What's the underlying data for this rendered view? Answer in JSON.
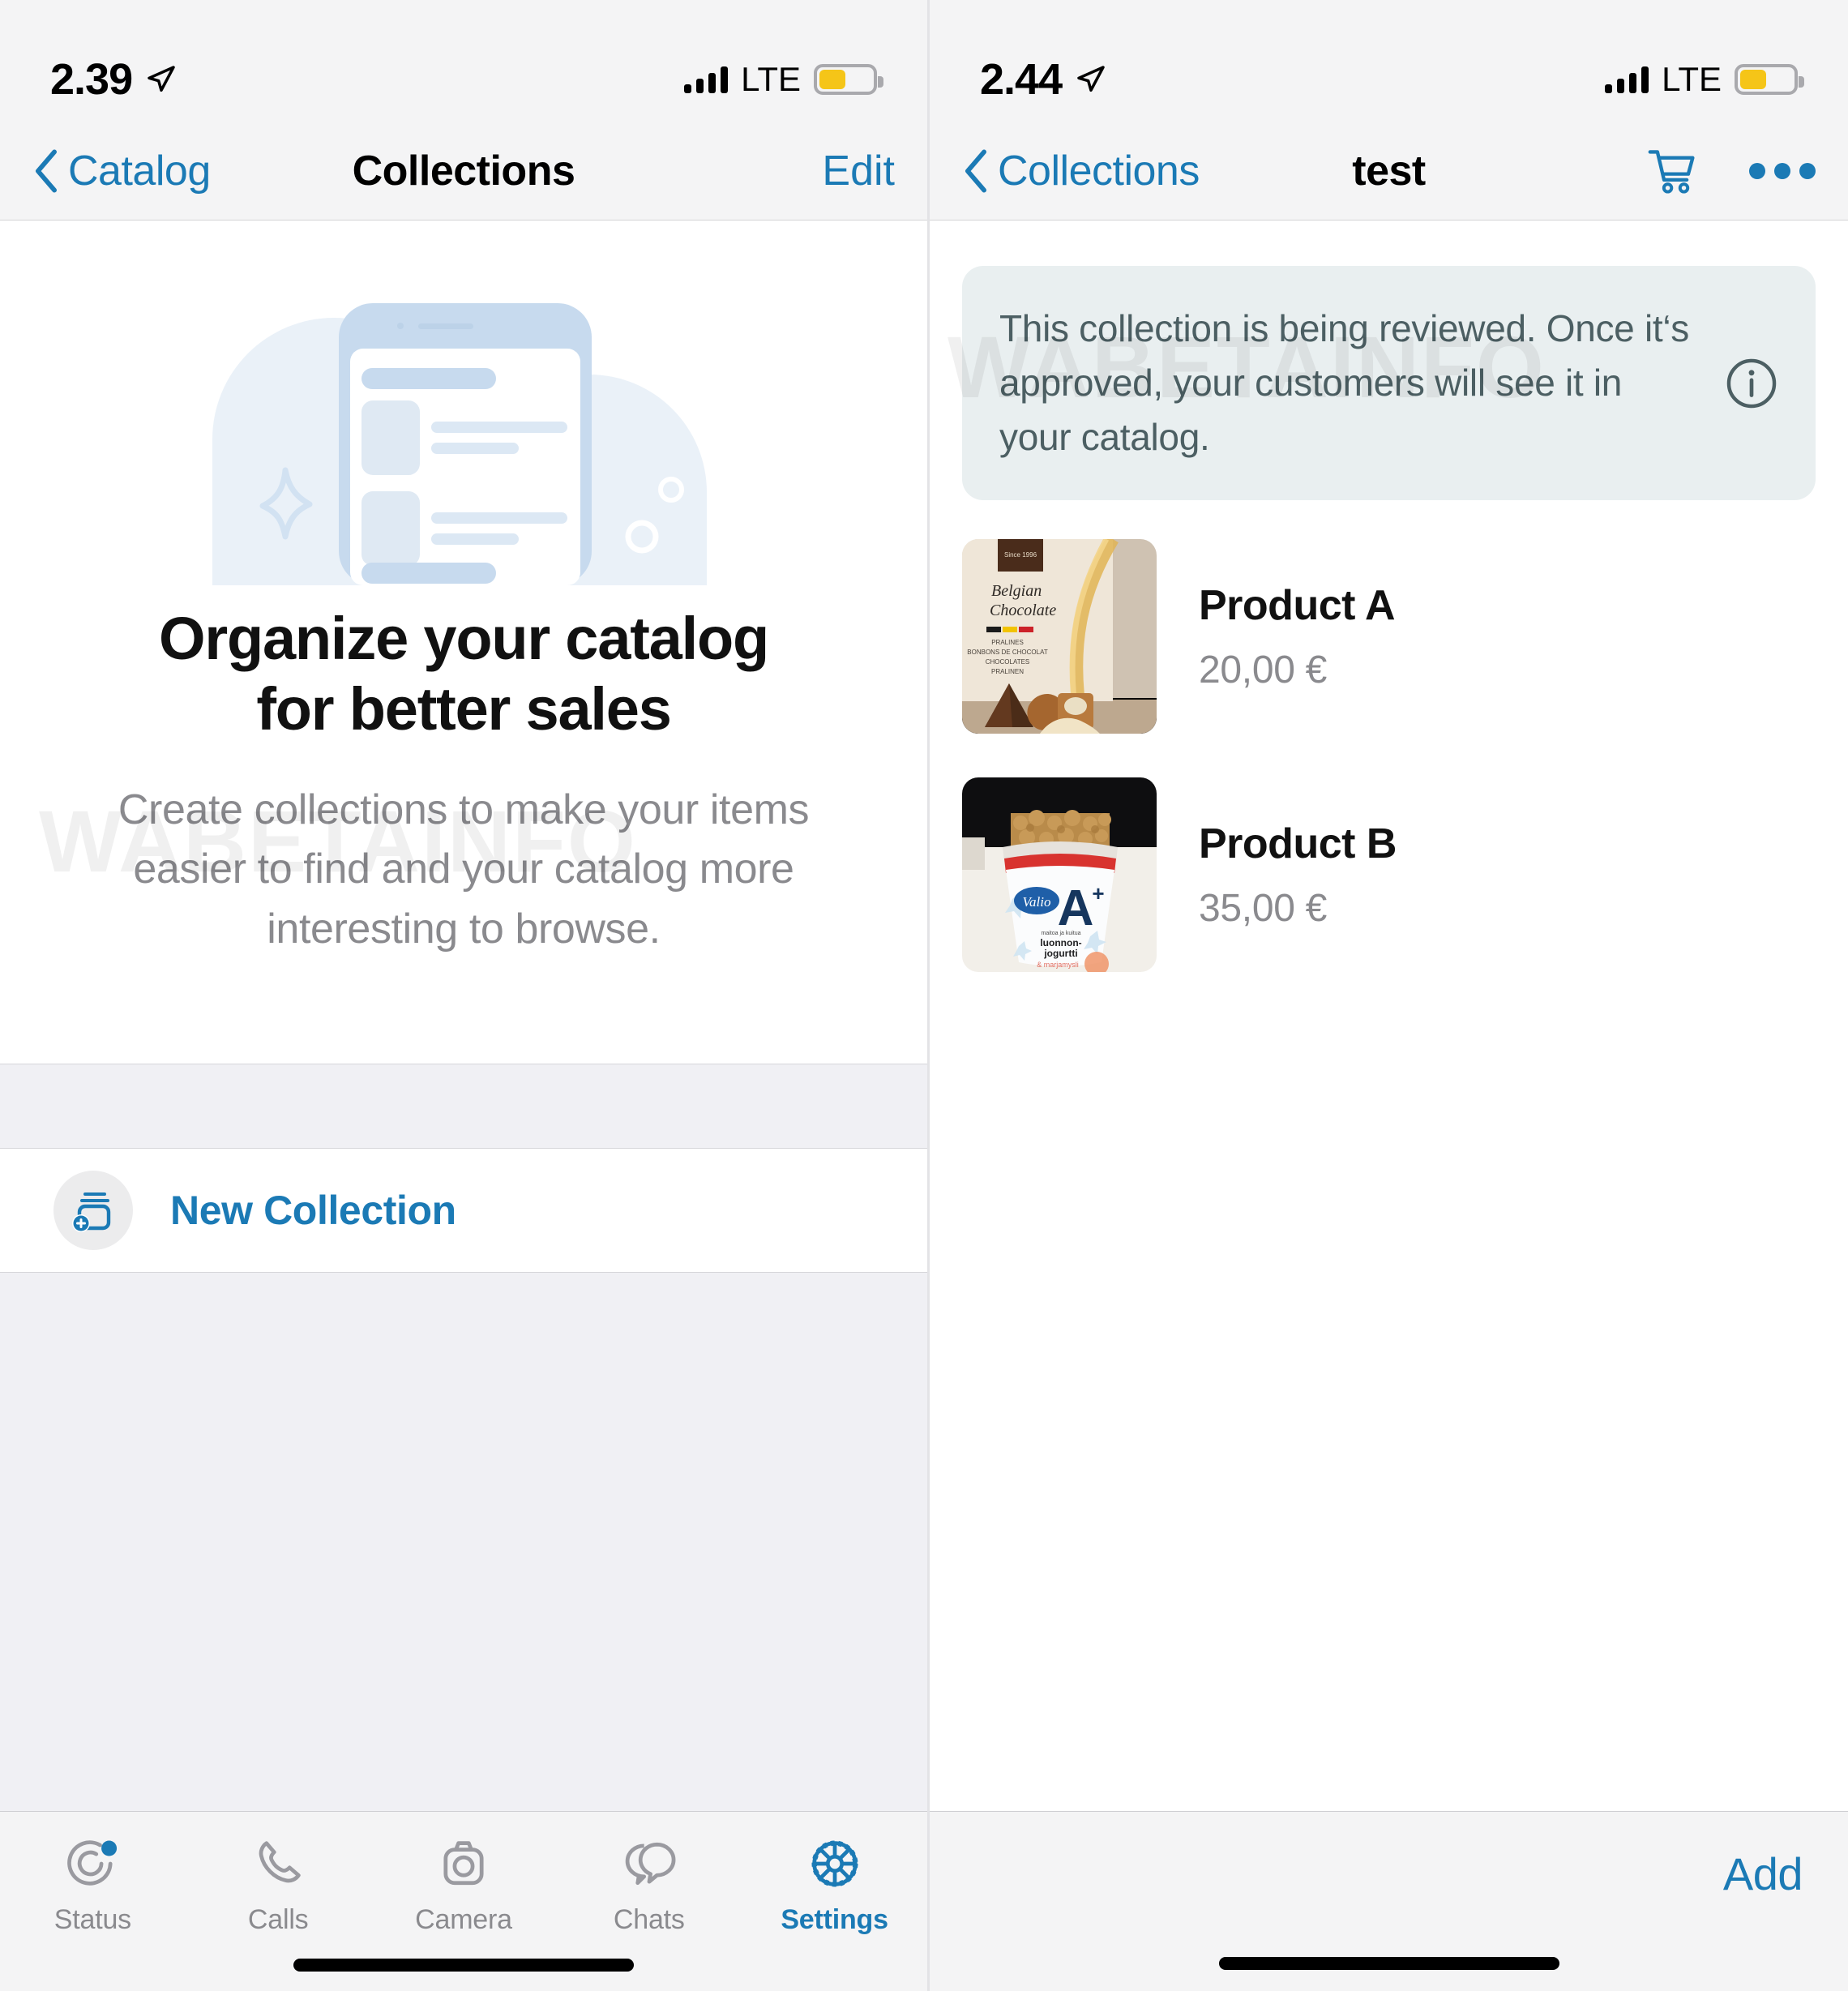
{
  "watermark": "WABETAINFO",
  "colors": {
    "accent": "#1b7ab5",
    "banner_bg": "#e9eff0",
    "bar_bg": "#f4f4f5",
    "battery": "#f5c518"
  },
  "left_screen": {
    "status_bar": {
      "time": "2.39",
      "carrier_tech": "LTE",
      "location_icon": "location-arrow-icon",
      "signal_icon": "signal-bars-icon",
      "battery_icon": "battery-low-power-icon"
    },
    "nav": {
      "back_label": "Catalog",
      "title": "Collections",
      "action_label": "Edit"
    },
    "empty_state": {
      "illustration": "catalog-phone-illustration",
      "title_line1": "Organize your catalog",
      "title_line2": "for better sales",
      "subtitle": "Create collections to make your items easier to find and your catalog more interesting to browse."
    },
    "new_collection": {
      "label": "New Collection",
      "icon": "add-collection-icon"
    },
    "tabbar": [
      {
        "label": "Status",
        "icon": "status-rings-icon",
        "active": false,
        "badge": true
      },
      {
        "label": "Calls",
        "icon": "phone-icon",
        "active": false,
        "badge": false
      },
      {
        "label": "Camera",
        "icon": "camera-icon",
        "active": false,
        "badge": false
      },
      {
        "label": "Chats",
        "icon": "chat-bubbles-icon",
        "active": false,
        "badge": false
      },
      {
        "label": "Settings",
        "icon": "gear-icon",
        "active": true,
        "badge": false
      }
    ]
  },
  "right_screen": {
    "status_bar": {
      "time": "2.44",
      "carrier_tech": "LTE",
      "location_icon": "location-arrow-icon",
      "signal_icon": "signal-bars-icon",
      "battery_icon": "battery-low-power-icon"
    },
    "nav": {
      "back_label": "Collections",
      "title": "test",
      "cart_icon": "shopping-cart-icon",
      "more_icon": "more-dots-icon"
    },
    "notice": {
      "text": "This collection is being reviewed. Once it‘s approved, your customers will see it in your catalog.",
      "icon": "info-circle-icon"
    },
    "products": [
      {
        "name": "Product A",
        "price": "20,00 €",
        "image": "belgian-chocolate-pralines-box"
      },
      {
        "name": "Product B",
        "price": "35,00 €",
        "image": "valio-a-plus-yogurt-cup"
      }
    ],
    "bottom_action": "Add"
  }
}
